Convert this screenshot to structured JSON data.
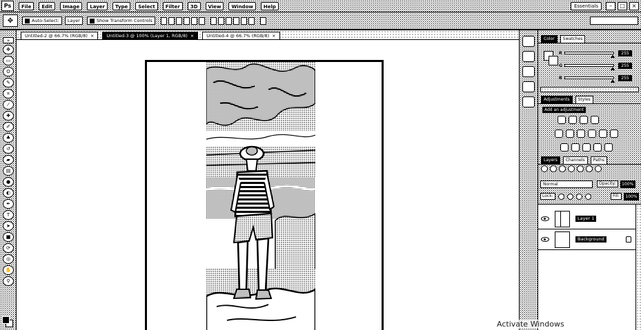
{
  "app": {
    "logo_text": "Ps"
  },
  "menu": [
    "File",
    "Edit",
    "Image",
    "Layer",
    "Type",
    "Select",
    "Filter",
    "3D",
    "View",
    "Window",
    "Help"
  ],
  "window_controls": {
    "workspace": "Essentials",
    "minimize": "–",
    "maximize": "□",
    "close": "×"
  },
  "options_bar": {
    "tool_icon": "move-tool-icon",
    "auto_select_label": "Auto-Select:",
    "auto_select_target": "Layer",
    "show_transform_label": "Show Transform Controls"
  },
  "doc_tabs": [
    {
      "label": "Untitled-2 @ 66.7% (RGB/8)",
      "active": false
    },
    {
      "label": "Untitled-3 @ 100% (Layer 1, RGB/8)",
      "active": true
    },
    {
      "label": "Untitled-4 @ 66.7% (RGB/8)",
      "active": false
    }
  ],
  "color_panel": {
    "tabs": [
      "Color",
      "Swatches"
    ],
    "sliders": [
      {
        "label": "R",
        "value": "255"
      },
      {
        "label": "G",
        "value": "255"
      },
      {
        "label": "B",
        "value": "255"
      }
    ]
  },
  "adjustments_panel": {
    "tabs": [
      "Adjustments",
      "Styles"
    ],
    "title": "Add an adjustment"
  },
  "layers_panel": {
    "tabs": [
      "Layers",
      "Channels",
      "Paths"
    ],
    "blend_mode": "Normal",
    "opacity_label": "Opacity:",
    "opacity_value": "100%",
    "lock_label": "Lock:",
    "fill_label": "Fill:",
    "fill_value": "100%",
    "layers": [
      {
        "name": "Layer 1",
        "locked": false
      },
      {
        "name": "Background",
        "locked": true
      }
    ]
  },
  "watermark": "Activate Windows"
}
